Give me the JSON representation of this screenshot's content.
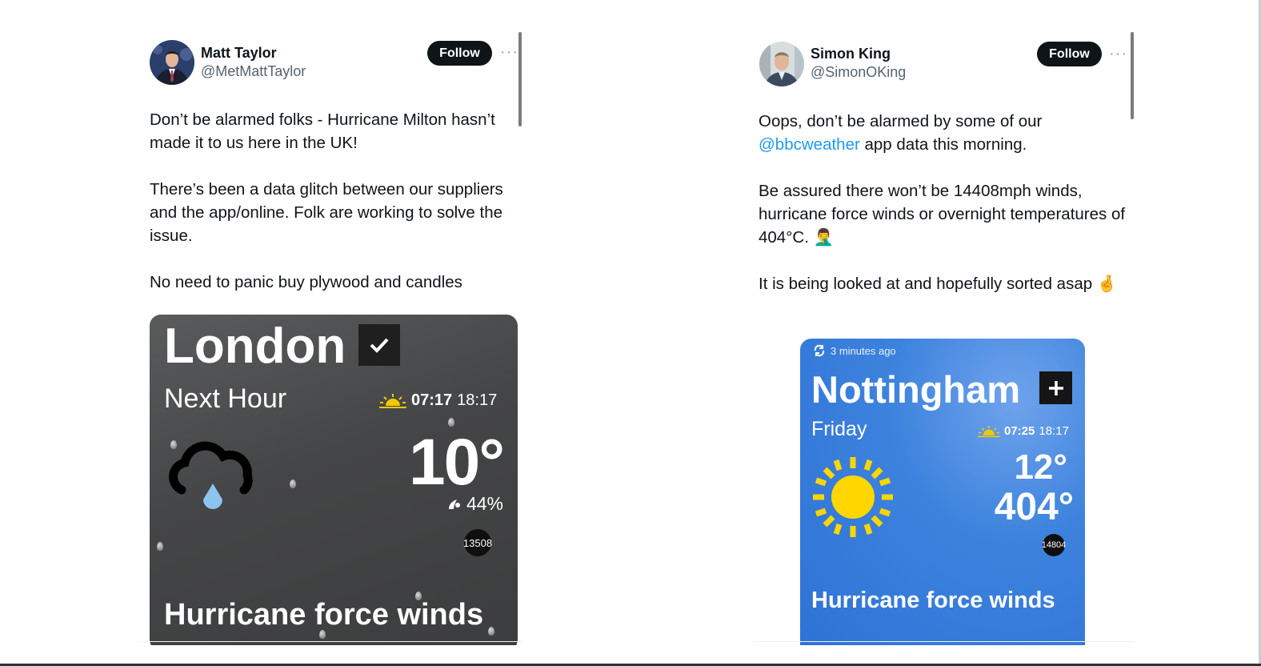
{
  "tweets": [
    {
      "author": {
        "name": "Matt Taylor",
        "handle": "@MetMattTaylor"
      },
      "follow_label": "Follow",
      "more_icon": "more-dots-icon",
      "paragraphs": [
        "Don’t be alarmed folks - Hurricane Milton hasn’t made it to us  here in the UK!",
        "There’s been a data glitch between our suppliers and the app/online. Folk are working to solve the issue.",
        "No need to panic buy plywood and candles"
      ],
      "card": {
        "city": "London",
        "subtitle": "Next Hour",
        "sunrise": "07:17",
        "sunset": "18:17",
        "temperature": "10°",
        "humidity": "44%",
        "wind_speed": "13508",
        "headline": "Hurricane force winds",
        "icons": {
          "status": "check-icon",
          "sun": "sunrise-icon",
          "weather": "rain-cloud-icon",
          "humidity": "humidity-icon"
        }
      }
    },
    {
      "author": {
        "name": "Simon King",
        "handle": "@SimonOKing"
      },
      "follow_label": "Follow",
      "more_icon": "more-dots-icon",
      "paragraph1_pre": "Oops, don’t be alarmed by some of our",
      "mention": "@bbcweather",
      "paragraph1_post": " app data this morning.",
      "paragraph2": "Be assured there won’t be 14408mph winds, hurricane force winds or overnight temperatures of 404°C. 🤦‍♂️",
      "paragraph3": "It is being looked at and hopefully sorted asap 🤞",
      "card": {
        "updated": "3 minutes ago",
        "city": "Nottingham",
        "day": "Friday",
        "sunrise": "07:25",
        "sunset": "18:17",
        "temp_high": "12°",
        "temp_low": "404°",
        "wind_speed": "14804",
        "headline": "Hurricane force winds",
        "icons": {
          "refresh": "refresh-icon",
          "add": "plus-icon",
          "sun": "sunrise-icon",
          "weather": "sun-icon"
        }
      }
    }
  ],
  "colors": {
    "link": "#1d9bf0",
    "follow_bg": "#0f1419",
    "card_blue": "#2f72d6",
    "card_grey": "#444546"
  }
}
